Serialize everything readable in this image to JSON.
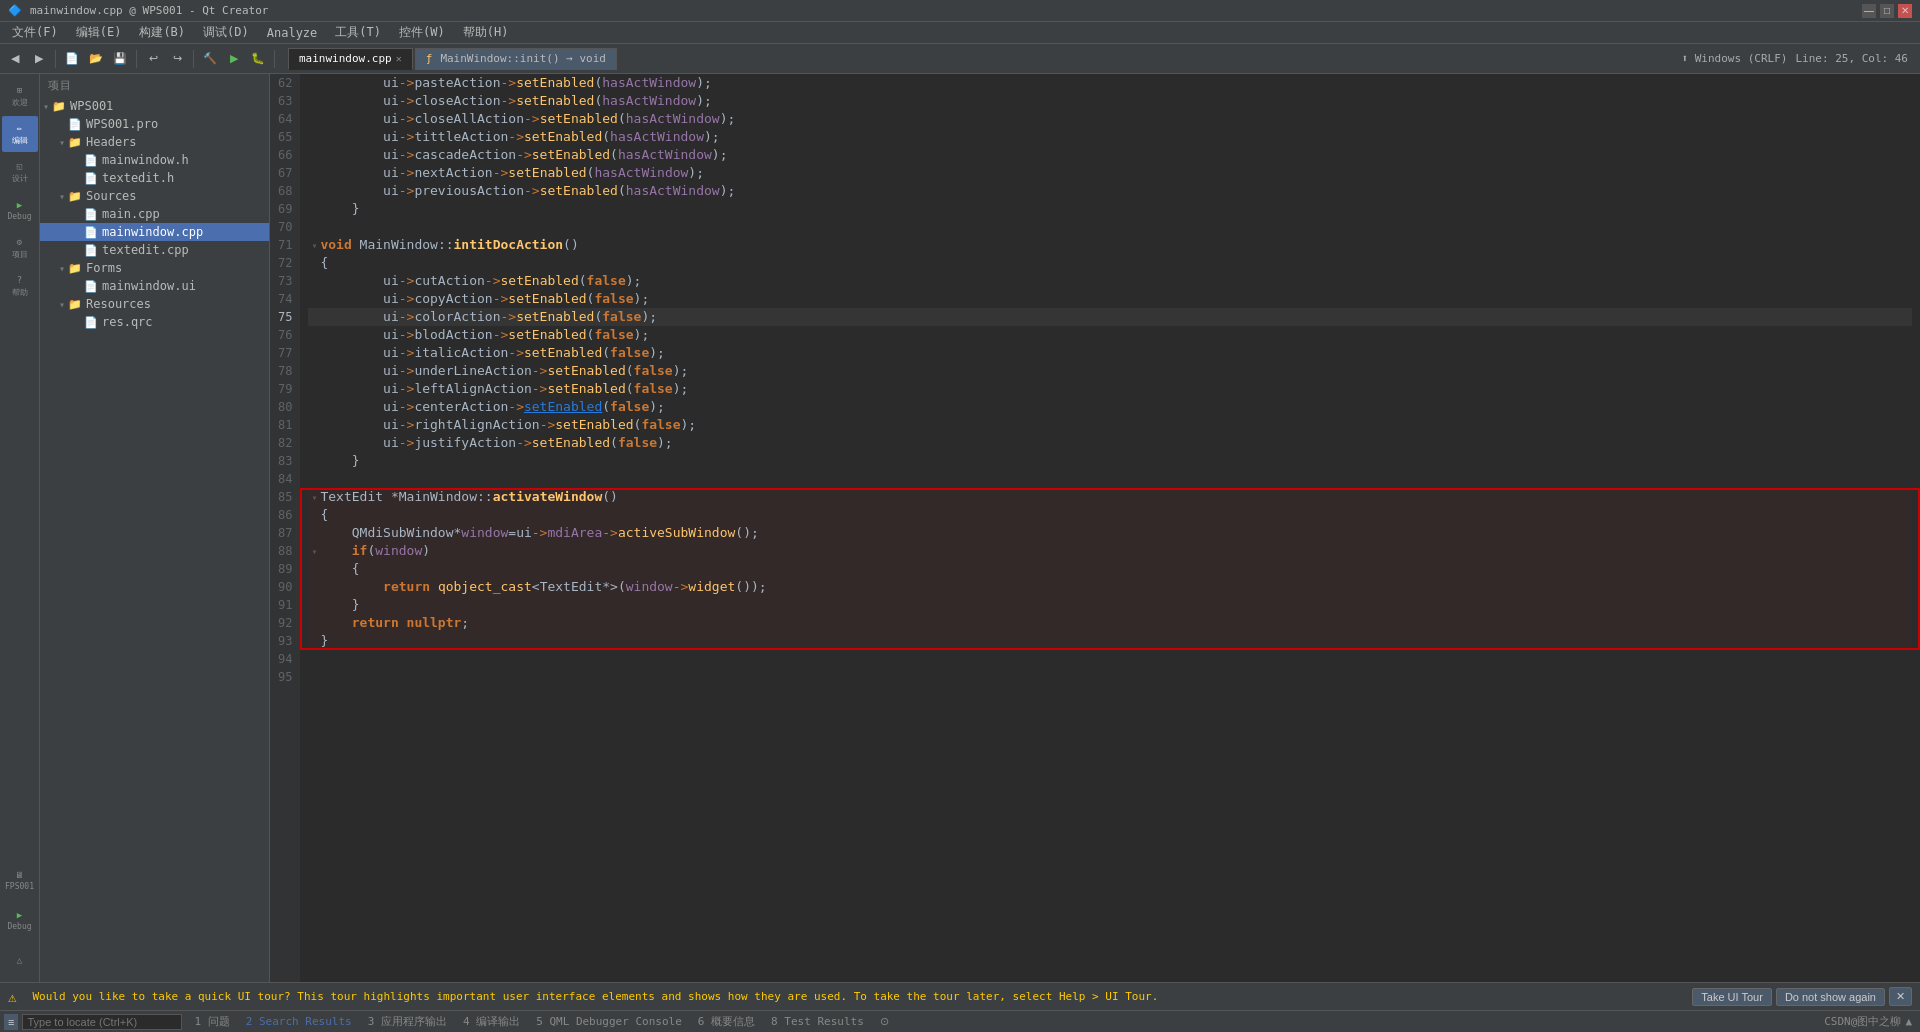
{
  "titleBar": {
    "title": "mainwindow.cpp @ WPS001 - Qt Creator",
    "minimize": "—",
    "maximize": "□",
    "close": "✕"
  },
  "menuBar": {
    "items": [
      "文件(F)",
      "编辑(E)",
      "构建(B)",
      "调试(D)",
      "Analyze",
      "工具(T)",
      "控件(W)",
      "帮助(H)"
    ]
  },
  "toolbar": {
    "tabs": [
      {
        "label": "mainwindow.cpp",
        "active": true,
        "hasClose": true
      },
      {
        "label": "MainWindow::init() → void",
        "active": false,
        "hasClose": false
      }
    ],
    "statusRight": "Windows (CRLF)    Line: 25, Col: 46"
  },
  "sidebar": {
    "icons": [
      {
        "id": "welcome",
        "label": "欢迎",
        "symbol": "⊞"
      },
      {
        "id": "edit",
        "label": "编辑",
        "symbol": "✏",
        "active": true
      },
      {
        "id": "design",
        "label": "设计",
        "symbol": "◱"
      },
      {
        "id": "debug",
        "label": "Debug",
        "symbol": "▶"
      },
      {
        "id": "project",
        "label": "项目",
        "symbol": "⚙"
      },
      {
        "id": "help",
        "label": "帮助",
        "symbol": "?"
      }
    ],
    "bottomIcons": [
      {
        "id": "fps001",
        "label": "FPS001",
        "symbol": "🖥"
      },
      {
        "id": "debug2",
        "label": "Debug",
        "symbol": "▶"
      },
      {
        "id": "output",
        "label": "",
        "symbol": "△"
      }
    ]
  },
  "fileTree": {
    "title": "项目",
    "items": [
      {
        "indent": 0,
        "arrow": "▾",
        "icon": "📁",
        "label": "WPS001",
        "isFolder": true
      },
      {
        "indent": 1,
        "arrow": "",
        "icon": "📄",
        "label": "WPS001.pro",
        "isFile": true
      },
      {
        "indent": 1,
        "arrow": "▾",
        "icon": "📁",
        "label": "Headers",
        "isFolder": true
      },
      {
        "indent": 2,
        "arrow": "",
        "icon": "📄",
        "label": "mainwindow.h",
        "isFile": true
      },
      {
        "indent": 2,
        "arrow": "",
        "icon": "📄",
        "label": "textedit.h",
        "isFile": true
      },
      {
        "indent": 1,
        "arrow": "▾",
        "icon": "📁",
        "label": "Sources",
        "isFolder": true
      },
      {
        "indent": 2,
        "arrow": "",
        "icon": "📄",
        "label": "main.cpp",
        "isFile": true
      },
      {
        "indent": 2,
        "arrow": "",
        "icon": "📄",
        "label": "mainwindow.cpp",
        "isFile": true,
        "selected": true
      },
      {
        "indent": 2,
        "arrow": "",
        "icon": "📄",
        "label": "textedit.cpp",
        "isFile": true
      },
      {
        "indent": 1,
        "arrow": "▾",
        "icon": "📁",
        "label": "Forms",
        "isFolder": true
      },
      {
        "indent": 2,
        "arrow": "",
        "icon": "📄",
        "label": "mainwindow.ui",
        "isFile": true
      },
      {
        "indent": 1,
        "arrow": "▾",
        "icon": "📁",
        "label": "Resources",
        "isFolder": true
      },
      {
        "indent": 2,
        "arrow": "",
        "icon": "📄",
        "label": "res.qrc",
        "isFile": true
      }
    ]
  },
  "codeLines": [
    {
      "num": 62,
      "content": "        ui->pasteAction->setEnabled(hasActWindow);",
      "fold": false,
      "type": "normal"
    },
    {
      "num": 63,
      "content": "        ui->closeAction->setEnabled(hasActWindow);",
      "fold": false,
      "type": "normal"
    },
    {
      "num": 64,
      "content": "        ui->closeAllAction->setEnabled(hasActWindow);",
      "fold": false,
      "type": "normal"
    },
    {
      "num": 65,
      "content": "        ui->tittleAction->setEnabled(hasActWindow);",
      "fold": false,
      "type": "normal"
    },
    {
      "num": 66,
      "content": "        ui->cascadeAction->setEnabled(hasActWindow);",
      "fold": false,
      "type": "normal"
    },
    {
      "num": 67,
      "content": "        ui->nextAction->setEnabled(hasActWindow);",
      "fold": false,
      "type": "normal"
    },
    {
      "num": 68,
      "content": "        ui->previousAction->setEnabled(hasActWindow);",
      "fold": false,
      "type": "normal"
    },
    {
      "num": 69,
      "content": "    }",
      "fold": false,
      "type": "normal"
    },
    {
      "num": 70,
      "content": "",
      "fold": false,
      "type": "normal"
    },
    {
      "num": 71,
      "content": "void MainWindow::intitDocAction()",
      "fold": false,
      "type": "normal"
    },
    {
      "num": 72,
      "content": "{",
      "fold": false,
      "type": "normal"
    },
    {
      "num": 73,
      "content": "        ui->cutAction->setEnabled(false);",
      "fold": false,
      "type": "normal"
    },
    {
      "num": 74,
      "content": "        ui->copyAction->setEnabled(false);",
      "fold": false,
      "type": "normal"
    },
    {
      "num": 75,
      "content": "        ui->colorAction->setEnabled(false);",
      "fold": false,
      "type": "normal",
      "current": true
    },
    {
      "num": 76,
      "content": "        ui->blodAction->setEnabled(false);",
      "fold": false,
      "type": "normal"
    },
    {
      "num": 77,
      "content": "        ui->italicAction->setEnabled(false);",
      "fold": false,
      "type": "normal"
    },
    {
      "num": 78,
      "content": "        ui->underLineAction->setEnabled(false);",
      "fold": false,
      "type": "normal"
    },
    {
      "num": 79,
      "content": "        ui->leftAlignAction->setEnabled(false);",
      "fold": false,
      "type": "normal"
    },
    {
      "num": 80,
      "content": "        ui->centerAction->setEnabled(false);",
      "fold": false,
      "type": "normal"
    },
    {
      "num": 81,
      "content": "        ui->rightAlignAction->setEnabled(false);",
      "fold": false,
      "type": "normal"
    },
    {
      "num": 82,
      "content": "        ui->justifyAction->setEnabled(false);",
      "fold": false,
      "type": "normal"
    },
    {
      "num": 83,
      "content": "    }",
      "fold": false,
      "type": "normal"
    },
    {
      "num": 84,
      "content": "",
      "fold": false,
      "type": "normal"
    },
    {
      "num": 85,
      "content": "TextEdit *MainWindow::activateWindow()",
      "fold": false,
      "type": "highlight-start"
    },
    {
      "num": 86,
      "content": "{",
      "fold": false,
      "type": "highlight"
    },
    {
      "num": 87,
      "content": "    QMdiSubWindow*window=ui->mdiArea->activeSubWindow();",
      "fold": false,
      "type": "highlight"
    },
    {
      "num": 88,
      "content": "    if(window)",
      "fold": false,
      "type": "highlight"
    },
    {
      "num": 89,
      "content": "    {",
      "fold": false,
      "type": "highlight"
    },
    {
      "num": 90,
      "content": "        return qobject_cast<TextEdit*>(window->widget());",
      "fold": false,
      "type": "highlight"
    },
    {
      "num": 91,
      "content": "    }",
      "fold": false,
      "type": "highlight"
    },
    {
      "num": 92,
      "content": "    return nullptr;",
      "fold": false,
      "type": "highlight"
    },
    {
      "num": 93,
      "content": "}",
      "fold": false,
      "type": "highlight-end"
    },
    {
      "num": 94,
      "content": "",
      "fold": false,
      "type": "normal"
    },
    {
      "num": 95,
      "content": "",
      "fold": false,
      "type": "normal"
    }
  ],
  "bottomPanel": {
    "message": "Would you like to take a quick UI tour? This tour highlights important user interface elements and shows how they are used. To take the tour later, select Help > UI Tour.",
    "btn1": "Take UI Tour",
    "btn2": "Do not show again",
    "close": "✕"
  },
  "statusBar": {
    "searchPlaceholder": "Type to locate (Ctrl+K)",
    "items": [
      {
        "num": "1",
        "label": "问题"
      },
      {
        "num": "2",
        "label": "Search Results",
        "active": true
      },
      {
        "num": "3",
        "label": "应用程序输出"
      },
      {
        "num": "4",
        "label": "编译输出"
      },
      {
        "num": "5",
        "label": "QML Debugger Console"
      },
      {
        "num": "6",
        "label": "概要信息"
      },
      {
        "num": "8",
        "label": "Test Results"
      }
    ],
    "rightInfo": "CSDN@图中之柳",
    "arrow": "▲"
  }
}
